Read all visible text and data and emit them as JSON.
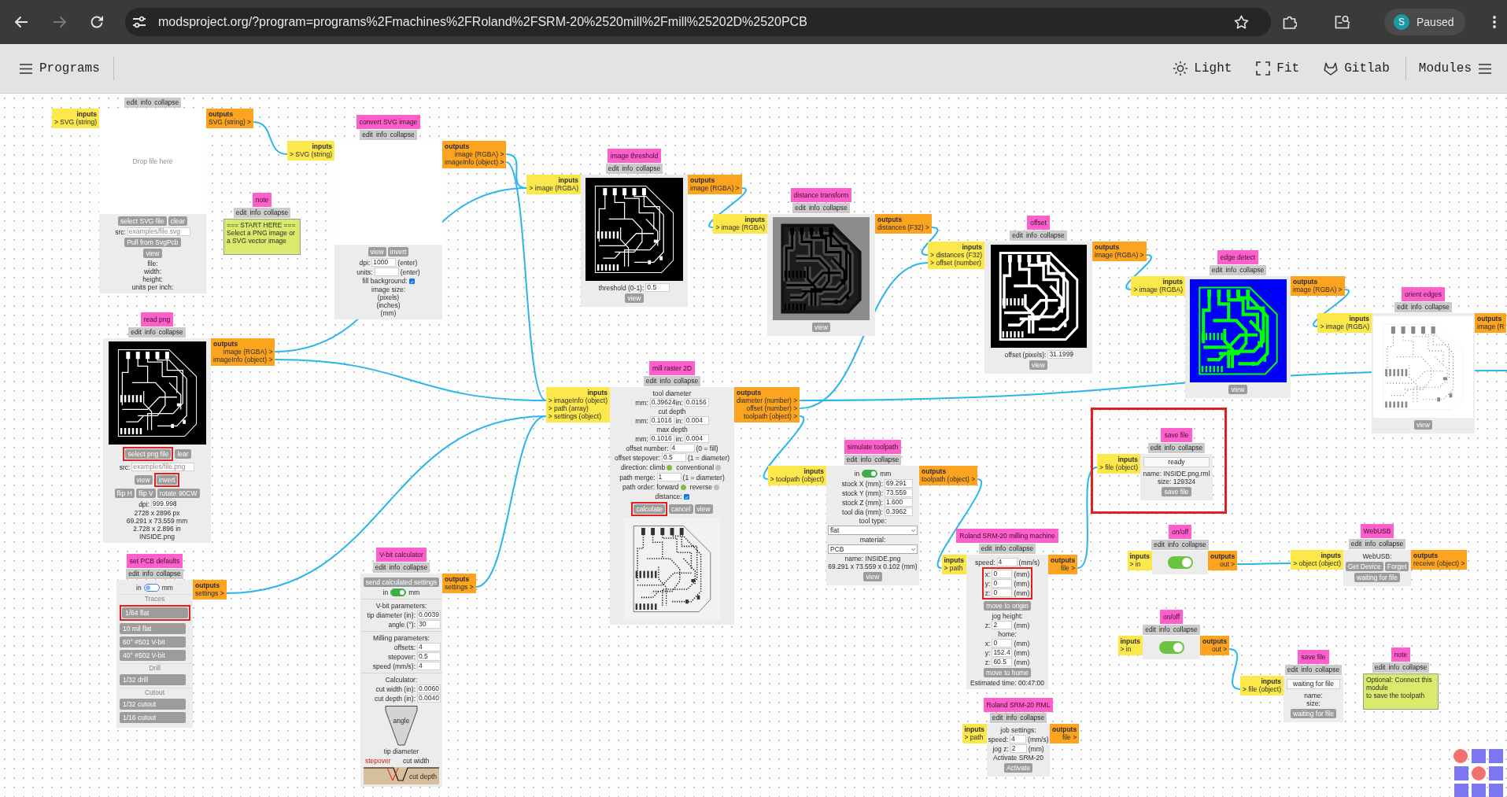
{
  "browser": {
    "back_disabled": false,
    "forward_disabled": true,
    "url": "modsproject.org/?program=programs%2Fmachines%2FRoland%2FSRM-20%2520mill%2Fmill%25202D%2520PCB",
    "profile_initial": "S",
    "profile_status": "Paused"
  },
  "toolbar": {
    "programs_label": "Programs",
    "actions": [
      "Light",
      "Fit",
      "Gitlab"
    ],
    "modules_label": "Modules"
  },
  "modules": [
    {
      "menu": [
        "edit",
        "info",
        "collapse"
      ],
      "highlighted": false,
      "inputs": {
        "heading": "inputs",
        "ports": [
          "> SVG (string)"
        ]
      },
      "outputs": {
        "heading": "outputs",
        "ports": [
          "SVG (string) >"
        ]
      },
      "rows": [
        {
          "kind": "dropzone",
          "placeholder": "Drop file here"
        },
        {
          "kind": "buttons",
          "buttons": [
            {
              "label": "select SVG file",
              "highlighted": false
            },
            {
              "label": "clear",
              "highlighted": false
            }
          ]
        },
        {
          "kind": "fields",
          "items": [
            {
              "label": "src:",
              "placeholder": "examples/file.svg"
            }
          ]
        },
        {
          "kind": "buttons",
          "buttons": [
            {
              "label": "Pull from SvgPcb",
              "highlighted": false
            }
          ]
        },
        {
          "kind": "buttons",
          "buttons": [
            {
              "label": "view",
              "highlighted": false
            }
          ]
        },
        {
          "kind": "text",
          "text": "file:"
        },
        {
          "kind": "text",
          "text": "width:"
        },
        {
          "kind": "text",
          "text": "height:"
        },
        {
          "kind": "text",
          "text": "units per inch:"
        }
      ]
    },
    {
      "title": "convert SVG image",
      "menu": [
        "edit",
        "info",
        "collapse"
      ],
      "highlighted": false,
      "inputs": {
        "heading": "inputs",
        "ports": [
          "> SVG (string)"
        ]
      },
      "outputs": {
        "heading": "outputs",
        "ports": [
          "image (RGBA) >",
          "imageInfo (object) >"
        ]
      },
      "rows": [
        {
          "kind": "blank_preview"
        },
        {
          "kind": "buttons",
          "buttons": [
            {
              "label": "view",
              "highlighted": false
            },
            {
              "label": "invert",
              "highlighted": false
            }
          ]
        },
        {
          "kind": "fields",
          "items": [
            {
              "label": "dpi:",
              "value": "1000"
            }
          ],
          "unit": "(enter)"
        },
        {
          "kind": "fields",
          "items": [
            {
              "label": "units:"
            }
          ],
          "unit": "(enter)"
        },
        {
          "kind": "checkbox",
          "label": "fill background:",
          "checked": true
        },
        {
          "kind": "text",
          "text": "image size:"
        },
        {
          "kind": "text",
          "text": "(pixels)"
        },
        {
          "kind": "text",
          "text": "(inches)"
        },
        {
          "kind": "text",
          "text": "(mm)"
        }
      ]
    },
    {
      "title": "image threshold",
      "menu": [
        "edit",
        "info",
        "collapse"
      ],
      "highlighted": false,
      "inputs": {
        "heading": "inputs",
        "ports": [
          "> image (RGBA)"
        ]
      },
      "outputs": {
        "heading": "outputs",
        "ports": [
          "image (RGBA) >"
        ]
      },
      "rows": [
        {
          "kind": "threshold_image"
        },
        {
          "kind": "fields",
          "items": [
            {
              "label": "threshold (0-1):",
              "value": "0.5"
            }
          ]
        },
        {
          "kind": "buttons",
          "buttons": [
            {
              "label": "view",
              "highlighted": false
            }
          ]
        }
      ]
    },
    {
      "title": "distance transform",
      "menu": [
        "edit",
        "info",
        "collapse"
      ],
      "highlighted": false,
      "inputs": {
        "heading": "inputs",
        "ports": [
          "> image (RGBA)"
        ]
      },
      "outputs": {
        "heading": "outputs",
        "ports": [
          "distances (F32) >"
        ]
      },
      "rows": [
        {
          "kind": "distance_image"
        },
        {
          "kind": "buttons",
          "buttons": [
            {
              "label": "view",
              "highlighted": false
            }
          ]
        }
      ]
    },
    {
      "title": "note",
      "menu": [
        "edit",
        "info",
        "collapse"
      ],
      "highlighted": false,
      "rows": [
        {
          "kind": "note",
          "lines": [
            "=== START HERE ===",
            "Select a PNG image or",
            "a SVG vector image"
          ]
        }
      ]
    },
    {
      "title": "offset",
      "menu": [
        "edit",
        "info",
        "collapse"
      ],
      "highlighted": false,
      "inputs": {
        "heading": "inputs",
        "ports": [
          "> distances (F32)",
          "> offset (number)"
        ]
      },
      "outputs": {
        "heading": "outputs",
        "ports": [
          "image (RGBA) >"
        ]
      },
      "rows": [
        {
          "kind": "offset_image"
        },
        {
          "kind": "fields",
          "items": [
            {
              "label": "offset (pixels):",
              "value": "31.1999"
            }
          ]
        },
        {
          "kind": "buttons",
          "buttons": [
            {
              "label": "view",
              "highlighted": false
            }
          ]
        }
      ]
    },
    {
      "title": "edge detect",
      "menu": [
        "edit",
        "info",
        "collapse"
      ],
      "highlighted": false,
      "inputs": {
        "heading": "inputs",
        "ports": [
          "> image (RGBA)"
        ]
      },
      "outputs": {
        "heading": "outputs",
        "ports": [
          "image (RGBA) >"
        ]
      },
      "rows": [
        {
          "kind": "edges_image"
        },
        {
          "kind": "buttons",
          "buttons": [
            {
              "label": "view",
              "highlighted": false
            }
          ]
        }
      ]
    },
    {
      "title": "orient edges",
      "menu": [
        "edit",
        "info",
        "collapse"
      ],
      "highlighted": false,
      "inputs": {
        "heading": "inputs",
        "ports": [
          "> image (RGBA)"
        ]
      },
      "outputs": {
        "heading": "outputs",
        "ports": [
          "image (R"
        ]
      },
      "rows": [
        {
          "kind": "orient_image"
        },
        {
          "kind": "buttons",
          "buttons": [
            {
              "label": "view",
              "highlighted": false
            }
          ]
        }
      ]
    },
    {
      "title": "read png",
      "menu": [
        "edit",
        "info",
        "collapse"
      ],
      "highlighted": false,
      "outputs": {
        "heading": "outputs",
        "ports": [
          "image (RGBA) >",
          "imageInfo (object) >"
        ]
      },
      "rows": [
        {
          "kind": "threshold_image"
        },
        {
          "kind": "buttons",
          "buttons": [
            {
              "label": "select png file",
              "highlighted": true
            },
            {
              "label": "lear",
              "highlighted": false
            }
          ]
        },
        {
          "kind": "fields",
          "items": [
            {
              "label": "src:",
              "placeholder": "examples/file.png"
            }
          ]
        },
        {
          "kind": "buttons",
          "buttons": [
            {
              "label": "view",
              "highlighted": false
            },
            {
              "label": "invert",
              "highlighted": true
            }
          ]
        },
        {
          "kind": "buttons",
          "buttons": [
            {
              "label": "flip H",
              "highlighted": false
            },
            {
              "label": "flip V",
              "highlighted": false
            },
            {
              "label": "rotate 90CW",
              "highlighted": false
            }
          ]
        },
        {
          "kind": "fields",
          "items": [
            {
              "label": "dpi:",
              "value": "999.998"
            }
          ]
        },
        {
          "kind": "text",
          "text": "2728 x 2896 px"
        },
        {
          "kind": "text",
          "text": "69.291 x 73.559 mm"
        },
        {
          "kind": "text",
          "text": "2.728 x 2.896 in"
        },
        {
          "kind": "text",
          "text": "INSIDE.png"
        }
      ]
    },
    {
      "title": "mill raster 2D",
      "menu": [
        "edit",
        "info",
        "collapse"
      ],
      "highlighted": false,
      "inputs": {
        "heading": "inputs",
        "ports": [
          "> imageInfo (object)",
          "> path (array)",
          "> settings (object)"
        ]
      },
      "outputs": {
        "heading": "outputs",
        "ports": [
          "diameter (number) >",
          "offset (number) >",
          "toolpath (object) >"
        ]
      },
      "rows": [
        {
          "kind": "text",
          "text": "tool diameter"
        },
        {
          "kind": "fields",
          "items": [
            {
              "label": "mm:",
              "value": "0.39624"
            },
            {
              "label": "in:",
              "value": "0.0156"
            }
          ]
        },
        {
          "kind": "text",
          "text": "cut depth"
        },
        {
          "kind": "fields",
          "items": [
            {
              "label": "mm:",
              "value": "0.1016"
            },
            {
              "label": "in:",
              "value": "0.004"
            }
          ]
        },
        {
          "kind": "text",
          "text": "max depth"
        },
        {
          "kind": "fields",
          "items": [
            {
              "label": "mm:",
              "value": "0.1016"
            },
            {
              "label": "in:",
              "value": "0.004"
            }
          ]
        },
        {
          "kind": "fields",
          "items": [
            {
              "label": "offset number:",
              "value": "4"
            }
          ],
          "unit": "(0 = fill)"
        },
        {
          "kind": "fields",
          "items": [
            {
              "label": "offset stepover:",
              "value": "0.5"
            }
          ],
          "unit": "(1 = diameter)"
        },
        {
          "kind": "radio",
          "label": "direction:",
          "options": [
            {
              "label": "climb",
              "selected": true
            },
            {
              "label": "conventional",
              "selected": false
            }
          ]
        },
        {
          "kind": "fields",
          "items": [
            {
              "label": "path merge:",
              "value": "1"
            }
          ],
          "unit": "(1 = diameter)"
        },
        {
          "kind": "radio",
          "label": "path order:",
          "options": [
            {
              "label": "forward",
              "selected": true
            },
            {
              "label": "reverse",
              "selected": false
            }
          ]
        },
        {
          "kind": "checkbox",
          "label": "distance:",
          "checked": true
        },
        {
          "kind": "buttons",
          "buttons": [
            {
              "label": "calculate",
              "highlighted": true
            },
            {
              "label": "cancel",
              "highlighted": false
            },
            {
              "label": "view",
              "highlighted": false
            }
          ]
        },
        {
          "kind": "toolpath_image"
        }
      ]
    },
    {
      "title": "save file",
      "menu": [
        "edit",
        "info",
        "collapse"
      ],
      "highlighted": true,
      "inputs": {
        "heading": "inputs",
        "ports": [
          "> file (object)"
        ]
      },
      "rows": [
        {
          "kind": "status",
          "value": "ready"
        },
        {
          "kind": "text",
          "text": "name: INSIDE.png.rml"
        },
        {
          "kind": "text",
          "text": "size: 129324"
        },
        {
          "kind": "buttons",
          "buttons": [
            {
              "label": "save file",
              "highlighted": false
            }
          ]
        }
      ]
    },
    {
      "title": "simulate toolpath",
      "menu": [
        "edit",
        "info",
        "collapse"
      ],
      "highlighted": false,
      "inputs": {
        "heading": "inputs",
        "ports": [
          "> toolpath (object)"
        ]
      },
      "outputs": {
        "heading": "outputs",
        "ports": [
          "toolpath (object) >"
        ]
      },
      "rows": [
        {
          "kind": "toggle",
          "left": "in",
          "right": "mm",
          "on": true
        },
        {
          "kind": "fields",
          "items": [
            {
              "label": "stock X (mm):",
              "value": "69.291"
            }
          ]
        },
        {
          "kind": "fields",
          "items": [
            {
              "label": "stock Y (mm):",
              "value": "73.559"
            }
          ]
        },
        {
          "kind": "fields",
          "items": [
            {
              "label": "stock Z (mm):",
              "value": "1.600"
            }
          ]
        },
        {
          "kind": "fields",
          "items": [
            {
              "label": "tool dia (mm):",
              "value": "0.3962"
            }
          ]
        },
        {
          "kind": "text",
          "text": "tool type:"
        },
        {
          "kind": "select",
          "value": "flat"
        },
        {
          "kind": "text",
          "text": "material:"
        },
        {
          "kind": "select",
          "value": "PCB"
        },
        {
          "kind": "text",
          "text": "name: INSIDE.png"
        },
        {
          "kind": "text",
          "text": "69.291 x 73.559 x 0.102 (mm)"
        },
        {
          "kind": "buttons",
          "buttons": [
            {
              "label": "view",
              "highlighted": false
            }
          ]
        }
      ]
    },
    {
      "title": "on/off",
      "menu": [
        "edit",
        "info",
        "collapse"
      ],
      "highlighted": false,
      "inputs": {
        "heading": "inputs",
        "ports": [
          "> in"
        ]
      },
      "outputs": {
        "heading": "outputs",
        "ports": [
          "out >"
        ]
      },
      "rows": [
        {
          "kind": "switch",
          "on": true
        }
      ]
    },
    {
      "title": "WebUSB",
      "menu": [
        "edit",
        "info",
        "collapse"
      ],
      "highlighted": false,
      "inputs": {
        "heading": "inputs",
        "ports": [
          "> object (object)"
        ]
      },
      "outputs": {
        "heading": "outputs",
        "ports": [
          "receive (object) >"
        ]
      },
      "rows": [
        {
          "kind": "text",
          "text": "WebUSB:"
        },
        {
          "kind": "buttons",
          "buttons": [
            {
              "label": "Get Device",
              "highlighted": false
            },
            {
              "label": "Forget",
              "highlighted": false
            }
          ]
        },
        {
          "kind": "buttons",
          "buttons": [
            {
              "label": "waiting for file",
              "highlighted": false
            }
          ]
        }
      ]
    },
    {
      "title": "Roland SRM-20 milling machine",
      "menu": [
        "edit",
        "info",
        "collapse"
      ],
      "highlighted": false,
      "inputs": {
        "heading": "inputs",
        "ports": [
          "> path"
        ]
      },
      "outputs": {
        "heading": "outputs",
        "ports": [
          "file >"
        ]
      },
      "rows": [
        {
          "kind": "fields",
          "items": [
            {
              "label": "speed:",
              "value": "4"
            }
          ],
          "unit": "(mm/s)"
        },
        {
          "kind": "group",
          "highlighted": true,
          "rows": [
            {
              "kind": "fields",
              "items": [
                {
                  "label": "x:",
                  "value": "0"
                }
              ],
              "unit": "(mm)"
            },
            {
              "kind": "fields",
              "items": [
                {
                  "label": "y:",
                  "value": "0"
                }
              ],
              "unit": "(mm)"
            },
            {
              "kind": "fields",
              "items": [
                {
                  "label": "z:",
                  "value": "0"
                }
              ],
              "unit": "(mm)"
            }
          ]
        },
        {
          "kind": "buttons",
          "buttons": [
            {
              "label": "move to origin",
              "highlighted": false
            }
          ]
        },
        {
          "kind": "text",
          "text": "jog height:"
        },
        {
          "kind": "fields",
          "items": [
            {
              "label": "z:",
              "value": "2"
            }
          ],
          "unit": "(mm)"
        },
        {
          "kind": "text",
          "text": "home:"
        },
        {
          "kind": "fields",
          "items": [
            {
              "label": "x:",
              "value": "0"
            }
          ],
          "unit": "(mm)"
        },
        {
          "kind": "fields",
          "items": [
            {
              "label": "y:",
              "value": "152.4"
            }
          ],
          "unit": "(mm)"
        },
        {
          "kind": "fields",
          "items": [
            {
              "label": "z:",
              "value": "60.5"
            }
          ],
          "unit": "(mm)"
        },
        {
          "kind": "buttons",
          "buttons": [
            {
              "label": "move to home",
              "highlighted": false
            }
          ]
        },
        {
          "kind": "text",
          "text": "Estimated time: 00:47:00"
        }
      ]
    },
    {
      "title": "V-bit calculator",
      "menu": [
        "edit",
        "info",
        "collapse"
      ],
      "highlighted": false,
      "outputs": {
        "heading": "outputs",
        "ports": [
          "settings >"
        ]
      },
      "rows": [
        {
          "kind": "buttons",
          "buttons": [
            {
              "label": "send calculated settings",
              "highlighted": false
            }
          ]
        },
        {
          "kind": "toggle",
          "left": "in",
          "right": "mm",
          "on": true
        },
        {
          "kind": "rule"
        },
        {
          "kind": "text",
          "text": "V-bit parameters:"
        },
        {
          "kind": "fields",
          "items": [
            {
              "label": "tip diameter (in):",
              "value": "0.0039"
            }
          ]
        },
        {
          "kind": "fields",
          "items": [
            {
              "label": "angle (°):",
              "value": "30"
            }
          ]
        },
        {
          "kind": "rule"
        },
        {
          "kind": "text",
          "text": "Milling parameters:"
        },
        {
          "kind": "fields",
          "items": [
            {
              "label": "offsets:",
              "value": "4"
            }
          ]
        },
        {
          "kind": "fields",
          "items": [
            {
              "label": "stepover:",
              "value": "0.5"
            }
          ]
        },
        {
          "kind": "fields",
          "items": [
            {
              "label": "speed (mm/s):",
              "value": "4"
            }
          ]
        },
        {
          "kind": "rule"
        },
        {
          "kind": "text",
          "text": "Calculator:"
        },
        {
          "kind": "fields",
          "items": [
            {
              "label": "cut width (in):",
              "value": "0.0060"
            }
          ]
        },
        {
          "kind": "fields",
          "items": [
            {
              "label": "cut depth (in):",
              "value": "0.0040"
            }
          ]
        },
        {
          "kind": "vbit_diagram",
          "labels": {
            "angle": "angle",
            "tip_diameter": "tip diameter",
            "stepover": "stepover",
            "cut_width": "cut width",
            "cut_depth": "cut depth"
          }
        }
      ]
    },
    {
      "title": "set PCB defaults",
      "menu": [
        "edit",
        "info",
        "collapse"
      ],
      "highlighted": false,
      "outputs": {
        "heading": "outputs",
        "ports": [
          "settings >"
        ]
      },
      "rows": [
        {
          "kind": "toggle",
          "left": "in",
          "right": "mm",
          "on": false
        },
        {
          "kind": "section",
          "text": "Traces"
        },
        {
          "kind": "preset",
          "button": {
            "label": "1/64 flat",
            "highlighted": true
          }
        },
        {
          "kind": "preset",
          "button": {
            "label": "10 mil flat",
            "highlighted": false
          }
        },
        {
          "kind": "preset",
          "button": {
            "label": "60° #501 V-bit",
            "highlighted": false
          }
        },
        {
          "kind": "preset",
          "button": {
            "label": "40° #502 V-bit",
            "highlighted": false
          }
        },
        {
          "kind": "section",
          "text": "Drill"
        },
        {
          "kind": "preset",
          "button": {
            "label": "1/32 drill",
            "highlighted": false
          }
        },
        {
          "kind": "section",
          "text": "Cutout"
        },
        {
          "kind": "preset",
          "button": {
            "label": "1/32 cutout",
            "highlighted": false
          }
        },
        {
          "kind": "preset",
          "button": {
            "label": "1/16 cutout",
            "highlighted": false
          }
        }
      ]
    },
    {
      "title": "on/off",
      "menu": [
        "edit",
        "info",
        "collapse"
      ],
      "highlighted": false,
      "inputs": {
        "heading": "inputs",
        "ports": [
          "> in"
        ]
      },
      "outputs": {
        "heading": "outputs",
        "ports": [
          "out >"
        ]
      },
      "rows": [
        {
          "kind": "switch",
          "on": true
        }
      ]
    },
    {
      "title": "save file",
      "menu": [
        "edit",
        "info",
        "collapse"
      ],
      "highlighted": false,
      "inputs": {
        "heading": "inputs",
        "ports": [
          "> file (object)"
        ]
      },
      "rows": [
        {
          "kind": "status",
          "value": "waiting for file"
        },
        {
          "kind": "text",
          "text": "name:"
        },
        {
          "kind": "text",
          "text": "size:"
        },
        {
          "kind": "buttons",
          "buttons": [
            {
              "label": "waiting for file",
              "highlighted": false
            }
          ]
        }
      ]
    },
    {
      "title": "note",
      "menu": [
        "edit",
        "info",
        "collapse"
      ],
      "highlighted": false,
      "rows": [
        {
          "kind": "note",
          "lines": [
            "Optional: Connect this",
            "module",
            "to save the toolpath"
          ]
        }
      ]
    },
    {
      "title": "Roland SRM-20 RML",
      "menu": [
        "edit",
        "info",
        "collapse"
      ],
      "highlighted": false,
      "inputs": {
        "heading": "inputs",
        "ports": [
          "> path"
        ]
      },
      "outputs": {
        "heading": "outputs",
        "ports": [
          "file >"
        ]
      },
      "rows": [
        {
          "kind": "text",
          "text": "job settings:"
        },
        {
          "kind": "fields",
          "items": [
            {
              "label": "speed:",
              "value": "4"
            }
          ],
          "unit": "(mm/s)"
        },
        {
          "kind": "fields",
          "items": [
            {
              "label": "jog z:",
              "value": "2"
            }
          ],
          "unit": "(mm)"
        },
        {
          "kind": "text",
          "text": "Activate SRM-20"
        },
        {
          "kind": "buttons",
          "buttons": [
            {
              "label": "Activate",
              "highlighted": false
            }
          ]
        }
      ]
    }
  ]
}
